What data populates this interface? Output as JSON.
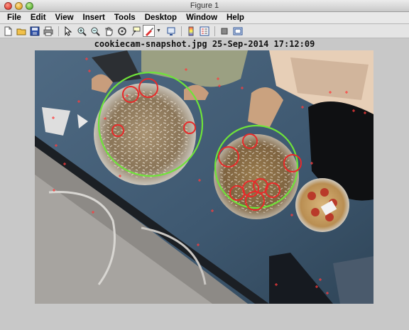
{
  "window": {
    "title": "Figure 1"
  },
  "menu": [
    "File",
    "Edit",
    "View",
    "Insert",
    "Tools",
    "Desktop",
    "Window",
    "Help"
  ],
  "toolbar": {
    "icons": [
      "new-figure-icon",
      "open-file-icon",
      "save-icon",
      "print-icon",
      "pointer-icon",
      "zoom-in-icon",
      "zoom-out-icon",
      "pan-icon",
      "rotate-3d-icon",
      "data-cursor-icon",
      "brush-icon",
      "link-plot-icon",
      "colorbar-icon",
      "legend-icon",
      "hide-plot-tools-icon",
      "show-plot-tools-icon"
    ]
  },
  "figure": {
    "title": "cookiecam-snapshot.jpg  25-Sep-2014 17:12:09"
  },
  "colors": {
    "plate_circle": "#6fe33a",
    "cookie_circle": "#e82a2a",
    "marker": "#ff3b3b"
  }
}
